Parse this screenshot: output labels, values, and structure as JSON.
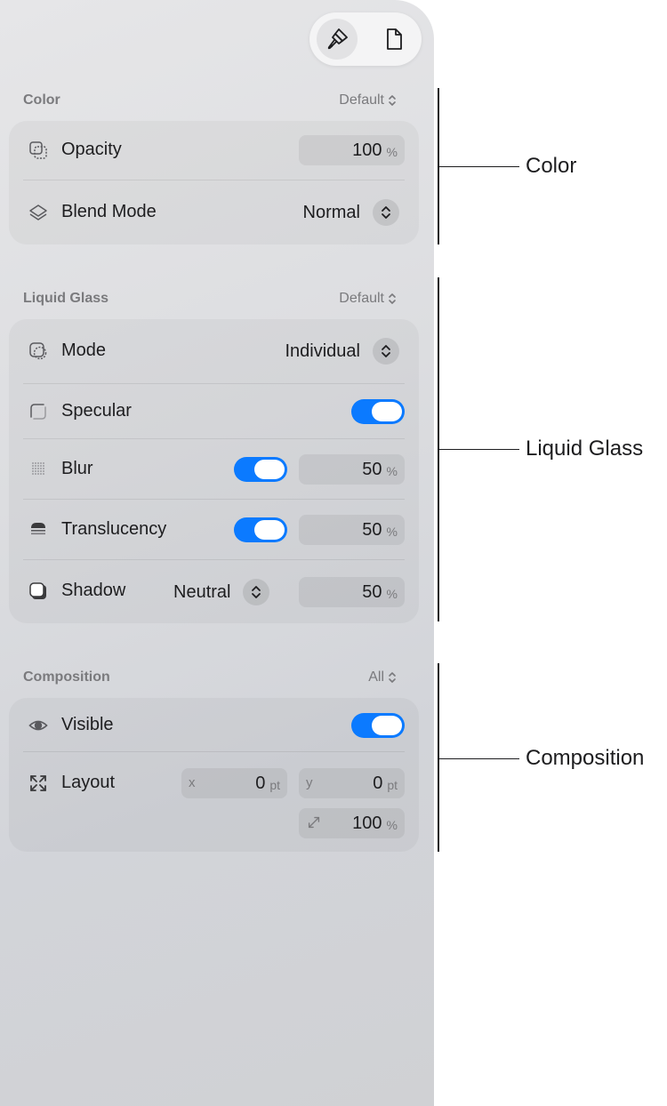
{
  "toolbar": {
    "format_icon": "paintbrush-icon",
    "document_icon": "document-icon"
  },
  "color": {
    "title": "Color",
    "menu": "Default",
    "opacity": {
      "label": "Opacity",
      "value": "100",
      "unit": "%"
    },
    "blend_mode": {
      "label": "Blend Mode",
      "value": "Normal"
    }
  },
  "liquid_glass": {
    "title": "Liquid Glass",
    "menu": "Default",
    "mode": {
      "label": "Mode",
      "value": "Individual"
    },
    "specular": {
      "label": "Specular",
      "enabled": true
    },
    "blur": {
      "label": "Blur",
      "enabled": true,
      "value": "50",
      "unit": "%"
    },
    "translucency": {
      "label": "Translucency",
      "enabled": true,
      "value": "50",
      "unit": "%"
    },
    "shadow": {
      "label": "Shadow",
      "style": "Neutral",
      "value": "50",
      "unit": "%"
    }
  },
  "composition": {
    "title": "Composition",
    "menu": "All",
    "visible": {
      "label": "Visible",
      "enabled": true
    },
    "layout": {
      "label": "Layout",
      "x_prefix": "x",
      "x_value": "0",
      "x_unit": "pt",
      "y_prefix": "y",
      "y_value": "0",
      "y_unit": "pt",
      "scale_value": "100",
      "scale_unit": "%"
    }
  },
  "callouts": {
    "color": "Color",
    "liquid_glass": "Liquid Glass",
    "composition": "Composition"
  },
  "colors": {
    "accent": "#0b7aff"
  }
}
